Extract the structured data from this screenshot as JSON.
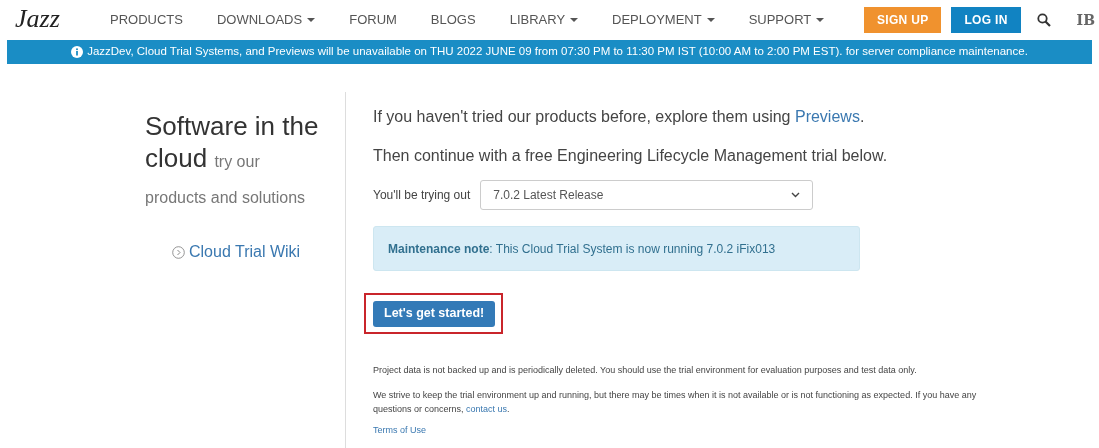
{
  "header": {
    "logo": "Jazz",
    "nav": [
      {
        "label": "PRODUCTS",
        "dropdown": false
      },
      {
        "label": "DOWNLOADS",
        "dropdown": true
      },
      {
        "label": "FORUM",
        "dropdown": false
      },
      {
        "label": "BLOGS",
        "dropdown": false
      },
      {
        "label": "LIBRARY",
        "dropdown": true
      },
      {
        "label": "DEPLOYMENT",
        "dropdown": true
      },
      {
        "label": "SUPPORT",
        "dropdown": true
      }
    ],
    "buttons": [
      "SIGN UP",
      "LOG IN"
    ],
    "brand": "IB"
  },
  "banner": "JazzDev, Cloud Trial Systems, and Previews will be unavailable on THU 2022 JUNE 09 from 07:30 PM to 11:30 PM IST (10:00 AM to 2:00 PM EST). for server compliance maintenance.",
  "sidebar": {
    "title": "Software in the cloud",
    "subtitle": "try our products and solutions",
    "link": "Cloud Trial Wiki"
  },
  "main": {
    "intro": {
      "before": "If you haven't tried our products before, explore them using ",
      "link": "Previews",
      "after": "."
    },
    "continue": "Then continue with a free Engineering Lifecycle Management trial below.",
    "release_label": "You'll be trying out",
    "release_value": "7.0.2 Latest Release",
    "note": "**Maintenance note**: This Cloud Trial System is now running 7.0.2 iFix013",
    "start_button": "Let's get started!",
    "disclaimer": "Project data is not backed up and is periodically deleted. You should use the trial environment for evaluation purposes and test data only.",
    "uptime": {
      "before": "We strive to keep the trial environment up and running, but there may be times when it is not available or is not functioning as expected. If you have any questions or concerns, ",
      "link": "contact us",
      "after": "."
    },
    "terms": "Terms of Use"
  }
}
